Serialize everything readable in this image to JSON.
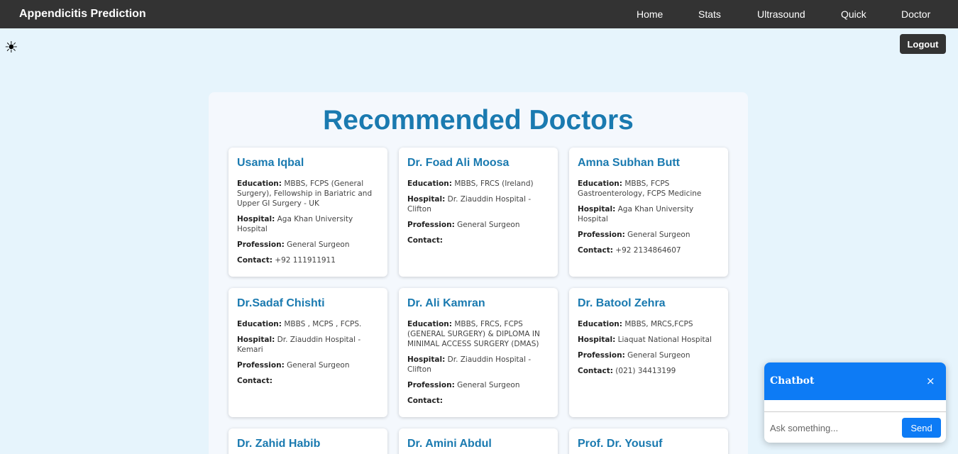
{
  "navbar": {
    "brand": "Appendicitis Prediction",
    "links": [
      "Home",
      "Stats",
      "Ultrasound",
      "Quick",
      "Doctor"
    ]
  },
  "theme_toggle": {
    "icon": "sun-icon",
    "glyph": "☀"
  },
  "logout_label": "Logout",
  "page_title": "Recommended Doctors",
  "field_labels": {
    "education": "Education:",
    "hospital": "Hospital:",
    "profession": "Profession:",
    "contact": "Contact:"
  },
  "doctors": [
    {
      "name": "Usama Iqbal",
      "education": "MBBS, FCPS (General Surgery), Fellowship in Bariatric and Upper GI Surgery - UK",
      "hospital": "Aga Khan University Hospital",
      "profession": "General Surgeon",
      "contact": "+92 111911911"
    },
    {
      "name": "Dr. Foad Ali Moosa",
      "education": "MBBS, FRCS (Ireland)",
      "hospital": "Dr. Ziauddin Hospital - Clifton",
      "profession": "General Surgeon",
      "contact": ""
    },
    {
      "name": "Amna Subhan Butt",
      "education": "MBBS, FCPS Gastroenterology, FCPS Medicine",
      "hospital": "Aga Khan University Hospital",
      "profession": "General Surgeon",
      "contact": "+92 2134864607"
    },
    {
      "name": "Dr.Sadaf Chishti",
      "education": "MBBS , MCPS , FCPS.",
      "hospital": "Dr. Ziauddin Hospital - Kemari",
      "profession": "General Surgeon",
      "contact": ""
    },
    {
      "name": "Dr. Ali Kamran",
      "education": "MBBS, FRCS, FCPS (GENERAL SURGERY) & DIPLOMA IN MINIMAL ACCESS SURGERY (DMAS)",
      "hospital": "Dr. Ziauddin Hospital - Clifton",
      "profession": "General Surgeon",
      "contact": ""
    },
    {
      "name": "Dr. Batool Zehra",
      "education": "MBBS, MRCS,FCPS",
      "hospital": "Liaquat National Hospital",
      "profession": "General Surgeon",
      "contact": "(021) 34413199"
    },
    {
      "name": "Dr. Zahid Habib"
    },
    {
      "name": "Dr. Amini Abdul"
    },
    {
      "name": "Prof. Dr. Yousuf"
    }
  ],
  "chatbot": {
    "title": "Chatbot",
    "close_glyph": "×",
    "input_placeholder": "Ask something...",
    "input_value": "",
    "send_label": "Send"
  },
  "colors": {
    "navbar_bg": "#333333",
    "page_bg": "#e6f4fc",
    "accent": "#1a7ab0",
    "chatbot_blue": "#0d7bf5"
  }
}
